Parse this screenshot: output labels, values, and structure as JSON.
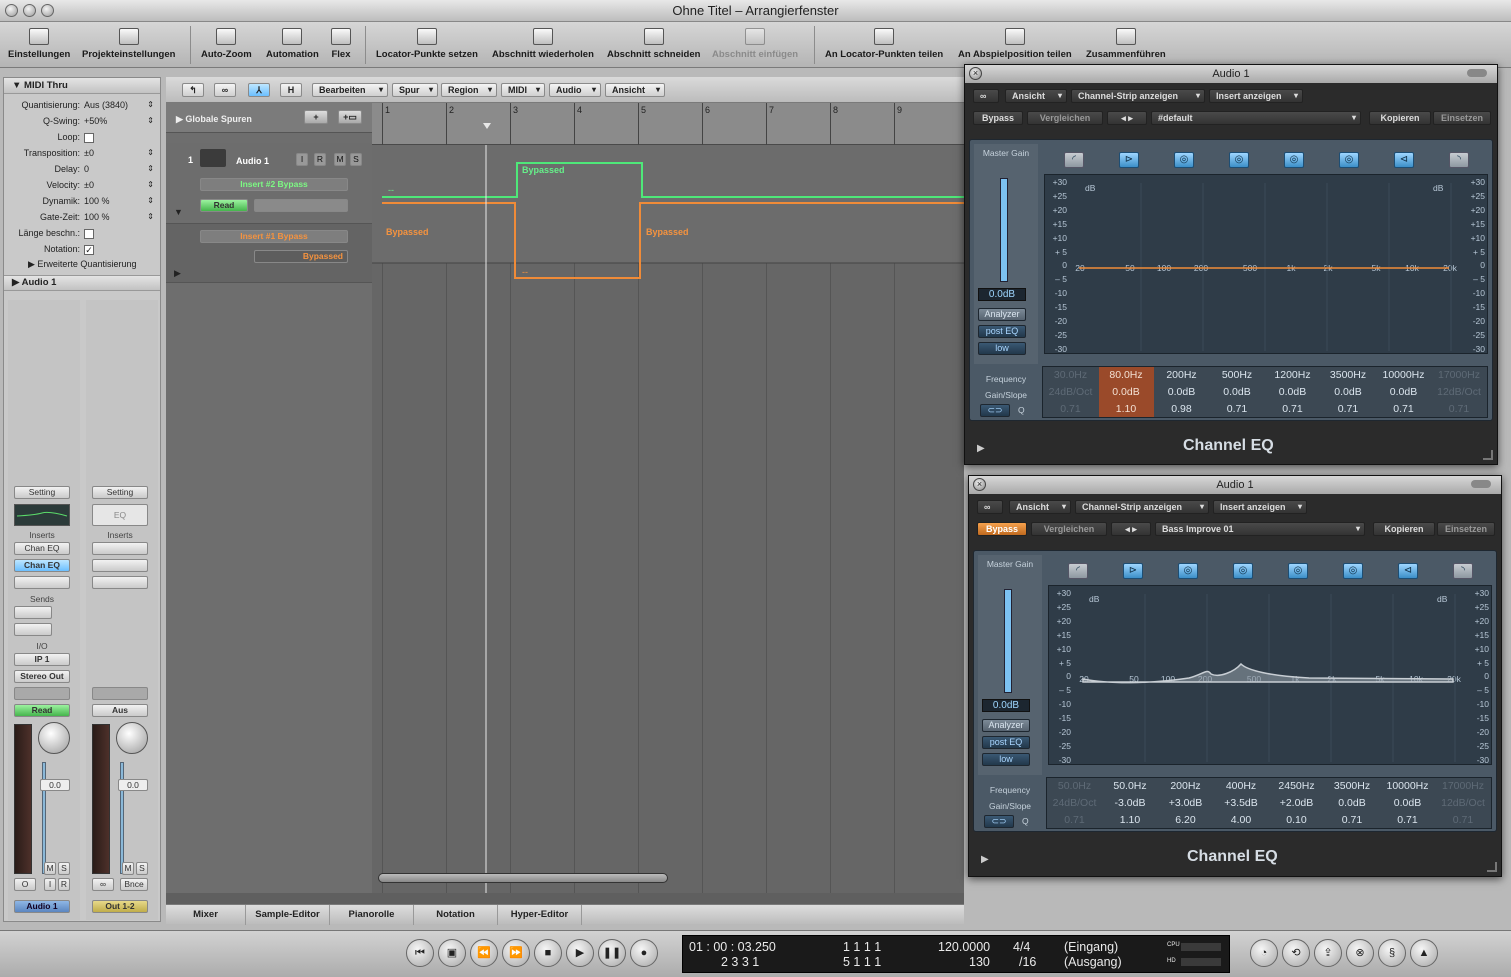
{
  "window": {
    "title": "Ohne Titel – Arrangierfenster"
  },
  "toolbar": {
    "einstellungen": "Einstellungen",
    "projekteinstellungen": "Projekteinstellungen",
    "autozoom": "Auto-Zoom",
    "automation": "Automation",
    "flex": "Flex",
    "locator_setzen": "Locator-Punkte setzen",
    "abschnitt_wiederholen": "Abschnitt wiederholen",
    "abschnitt_schneiden": "Abschnitt schneiden",
    "abschnitt_einfuegen": "Abschnitt einfügen",
    "locator_teilen": "An Locator-Punkten teilen",
    "abspielposition_teilen": "An Abspielposition teilen",
    "zusammenfuehren": "Zusammenführen"
  },
  "inspector": {
    "region_header": "MIDI Thru",
    "rows": [
      {
        "label": "Quantisierung:",
        "value": "Aus (3840)"
      },
      {
        "label": "Q-Swing:",
        "value": "+50%"
      },
      {
        "label": "Loop:",
        "value": ""
      },
      {
        "label": "Transposition:",
        "value": "±0"
      },
      {
        "label": "Delay:",
        "value": "0"
      },
      {
        "label": "Velocity:",
        "value": "±0"
      },
      {
        "label": "Dynamik:",
        "value": "100 %"
      },
      {
        "label": "Gate-Zeit:",
        "value": "100 %"
      },
      {
        "label": "Länge beschn.:",
        "value": ""
      },
      {
        "label": "Notation:",
        "value": "✓"
      }
    ],
    "extended_quant": "Erweiterte Quantisierung",
    "track_header": "Audio 1",
    "strip1": {
      "setting": "Setting",
      "inserts": "Inserts",
      "insert1": "Chan EQ",
      "insert2": "Chan EQ",
      "sends": "Sends",
      "io": "I/O",
      "input": "IP 1",
      "output": "Stereo Out",
      "automation": "Read",
      "volume": "0.0",
      "m": "M",
      "s": "S",
      "i": "I",
      "r": "R",
      "o": "O",
      "name": "Audio 1"
    },
    "strip2": {
      "setting": "Setting",
      "eq": "EQ",
      "inserts": "Inserts",
      "automation": "Aus",
      "volume": "0.0",
      "m": "M",
      "s": "S",
      "bnce": "Bnce",
      "name": "Out 1-2"
    }
  },
  "arrange": {
    "menus": {
      "bearbeiten": "Bearbeiten",
      "spur": "Spur",
      "region": "Region",
      "midi": "MIDI",
      "audio": "Audio",
      "ansicht": "Ansicht",
      "h": "H"
    },
    "global_tracks": "Globale Spuren",
    "track": {
      "number": "1",
      "name": "Audio 1",
      "i": "I",
      "r": "R",
      "m": "M",
      "s": "S",
      "insert2_bypass": "Insert #2 Bypass",
      "read": "Read",
      "insert1_bypass": "Insert #1 Bypass",
      "bypassed_value": "Bypassed"
    },
    "ruler": [
      "1",
      "2",
      "3",
      "4",
      "5",
      "6",
      "7",
      "8",
      "9"
    ],
    "automation_labels": {
      "green": "Bypassed",
      "orange_left": "Bypassed",
      "orange_right": "Bypassed",
      "dash": "--"
    }
  },
  "bottom_tabs": [
    "Mixer",
    "Sample-Editor",
    "Pianorolle",
    "Notation",
    "Hyper-Editor"
  ],
  "transport": {
    "smpte": "01 : 00 : 03.250",
    "bars": "2   3   3     1",
    "locator_l": "1     1     1     1",
    "locator_r": "5     1     1     1",
    "tempo": "120.0000",
    "tempo2": "130",
    "sig": "4/4",
    "div": "/16",
    "in": "(Eingang)",
    "out": "(Ausgang)",
    "cpu": "CPU",
    "hd": "HD"
  },
  "eq_common": {
    "ansicht": "Ansicht",
    "strip": "Channel-Strip anzeigen",
    "insert": "Insert anzeigen",
    "bypass": "Bypass",
    "compare": "Vergleichen",
    "copy": "Kopieren",
    "paste": "Einsetzen",
    "master_gain": "Master Gain",
    "analyzer": "Analyzer",
    "post_eq": "post EQ",
    "low": "low",
    "frequency": "Frequency",
    "gain_slope": "Gain/Slope",
    "q": "Q",
    "db": "dB",
    "name": "Channel EQ",
    "db_ticks": [
      "+30",
      "+25",
      "+20",
      "+15",
      "+10",
      "+ 5",
      "0",
      "– 5",
      "-10",
      "-15",
      "-20",
      "-25",
      "-30"
    ],
    "freq_ticks": [
      "20",
      "50",
      "100",
      "200",
      "500",
      "1k",
      "2k",
      "5k",
      "10k",
      "20k"
    ]
  },
  "eq1": {
    "title": "Audio 1",
    "preset": "#default",
    "gain": "0.0dB",
    "bands": [
      {
        "f": "30.0Hz",
        "g": "24dB/Oct",
        "q": "0.71"
      },
      {
        "f": "80.0Hz",
        "g": "0.0dB",
        "q": "1.10"
      },
      {
        "f": "200Hz",
        "g": "0.0dB",
        "q": "0.98"
      },
      {
        "f": "500Hz",
        "g": "0.0dB",
        "q": "0.71"
      },
      {
        "f": "1200Hz",
        "g": "0.0dB",
        "q": "0.71"
      },
      {
        "f": "3500Hz",
        "g": "0.0dB",
        "q": "0.71"
      },
      {
        "f": "10000Hz",
        "g": "0.0dB",
        "q": "0.71"
      },
      {
        "f": "17000Hz",
        "g": "12dB/Oct",
        "q": "0.71"
      }
    ]
  },
  "eq2": {
    "title": "Audio 1",
    "preset": "Bass Improve 01",
    "gain": "0.0dB",
    "bands": [
      {
        "f": "50.0Hz",
        "g": "24dB/Oct",
        "q": "0.71"
      },
      {
        "f": "50.0Hz",
        "g": "-3.0dB",
        "q": "1.10"
      },
      {
        "f": "200Hz",
        "g": "+3.0dB",
        "q": "6.20"
      },
      {
        "f": "400Hz",
        "g": "+3.5dB",
        "q": "4.00"
      },
      {
        "f": "2450Hz",
        "g": "+2.0dB",
        "q": "0.10"
      },
      {
        "f": "3500Hz",
        "g": "0.0dB",
        "q": "0.71"
      },
      {
        "f": "10000Hz",
        "g": "0.0dB",
        "q": "0.71"
      },
      {
        "f": "17000Hz",
        "g": "12dB/Oct",
        "q": "0.71"
      }
    ]
  }
}
